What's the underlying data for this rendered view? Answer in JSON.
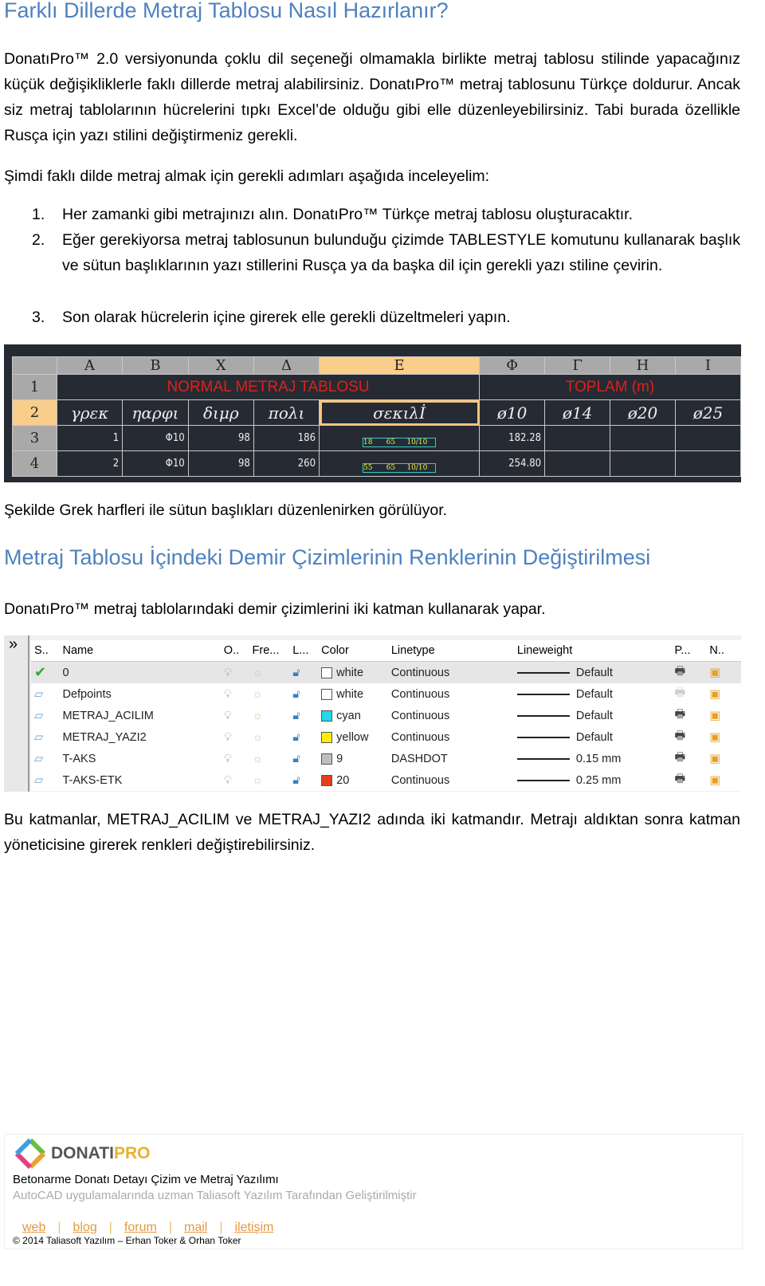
{
  "heading1": "Farklı Dillerde Metraj Tablosu Nasıl Hazırlanır?",
  "para1": "DonatıPro™ 2.0 versiyonunda çoklu dil seçeneği olmamakla birlikte metraj tablosu stilinde yapacağınız küçük değişikliklerle faklı dillerde metraj alabilirsiniz. DonatıPro™ metraj tablosunu Türkçe doldurur. Ancak siz metraj tablolarının hücrelerini tıpkı Excel’de olduğu gibi elle düzenleyebilirsiniz. Tabi burada özellikle Rusça için yazı stilini değiştirmeniz gerekli.",
  "para2": "Şimdi faklı dilde metraj almak için gerekli adımları aşağıda inceleyelim:",
  "steps": [
    {
      "n": "1.",
      "text": "Her zamanki gibi metrajınızı alın. DonatıPro™ Türkçe metraj tablosu oluşturacaktır."
    },
    {
      "n": "2.",
      "text": "Eğer gerekiyorsa metraj tablosunun bulunduğu çizimde TABLESTYLE komutunu kullanarak başlık ve sütun başlıklarının yazı stillerini Rusça ya da başka dil için gerekli yazı stiline çevirin."
    },
    {
      "n": "3.",
      "text": "Son olarak hücrelerin içine girerek elle gerekli düzeltmeleri yapın."
    }
  ],
  "cad": {
    "cols": [
      "A",
      "B",
      "X",
      "Δ",
      "E",
      "Φ",
      "Γ",
      "H",
      "I"
    ],
    "rownums": [
      "1",
      "2",
      "3",
      "4"
    ],
    "title1": "NORMAL METRAJ TABLOSU",
    "title2": "TOPLAM (m)",
    "headers": [
      "γρεκ",
      "ηαρφι",
      "διμρ",
      "πολι",
      "σεκιλİ",
      "ø10",
      "ø14",
      "ø20",
      "ø25"
    ],
    "rows": [
      [
        "1",
        "Φ10",
        "98",
        "186",
        [
          "18",
          "65",
          "10/10"
        ],
        "182.28",
        "",
        "",
        ""
      ],
      [
        "2",
        "Φ10",
        "98",
        "260",
        [
          "55",
          "65",
          "10/10"
        ],
        "254.80",
        "",
        "",
        ""
      ]
    ],
    "selected_color": "#f9cd8a",
    "title_color": "#e0201a"
  },
  "caption1": "Şekilde Grek harfleri ile sütun başlıkları düzenlenirken görülüyor.",
  "heading2": "Metraj Tablosu İçindeki Demir Çizimlerinin Renklerinin Değiştirilmesi",
  "para3": "DonatıPro™ metraj tablolarındaki demir çizimlerini iki katman kullanarak yapar.",
  "layers": {
    "expand": "»",
    "columns": [
      "S..",
      "Name",
      "O..",
      "Fre...",
      "L...",
      "Color",
      "Linetype",
      "Lineweight",
      "P...",
      "N.."
    ],
    "rows": [
      {
        "name": "0",
        "color": "white",
        "hex": "#ffffff",
        "linetype": "Continuous",
        "lineweight": "Default",
        "current": true
      },
      {
        "name": "Defpoints",
        "color": "white",
        "hex": "#ffffff",
        "linetype": "Continuous",
        "lineweight": "Default"
      },
      {
        "name": "METRAJ_ACILIM",
        "color": "cyan",
        "hex": "#22d8e8",
        "linetype": "Continuous",
        "lineweight": "Default"
      },
      {
        "name": "METRAJ_YAZI2",
        "color": "yellow",
        "hex": "#ffee00",
        "linetype": "Continuous",
        "lineweight": "Default"
      },
      {
        "name": "T-AKS",
        "color": "9",
        "hex": "#bfbfbf",
        "linetype": "DASHDOT",
        "lineweight": "0.15 mm"
      },
      {
        "name": "T-AKS-ETK",
        "color": "20",
        "hex": "#e0401a",
        "linetype": "Continuous",
        "lineweight": "0.25 mm"
      }
    ]
  },
  "para4": "Bu katmanlar, METRAJ_ACILIM ve METRAJ_YAZI2 adında iki katmandır. Metrajı aldıktan sonra katman yöneticisine girerek renkleri değiştirebilirsiniz.",
  "footer": {
    "logo_text": "DONATIPRO",
    "tagline": "Betonarme Donatı Detayı Çizim ve Metraj Yazılımı",
    "subtitle": "AutoCAD uygulamalarında uzman Taliasoft Yazılım Tarafından Geliştirilmiştir",
    "links": [
      "web",
      "blog",
      "forum",
      "mail",
      "iletişim"
    ],
    "copyright": "© 2014 Taliasoft Yazılım – Erhan Toker & Orhan Toker"
  },
  "heading_color": "#4f81bd"
}
